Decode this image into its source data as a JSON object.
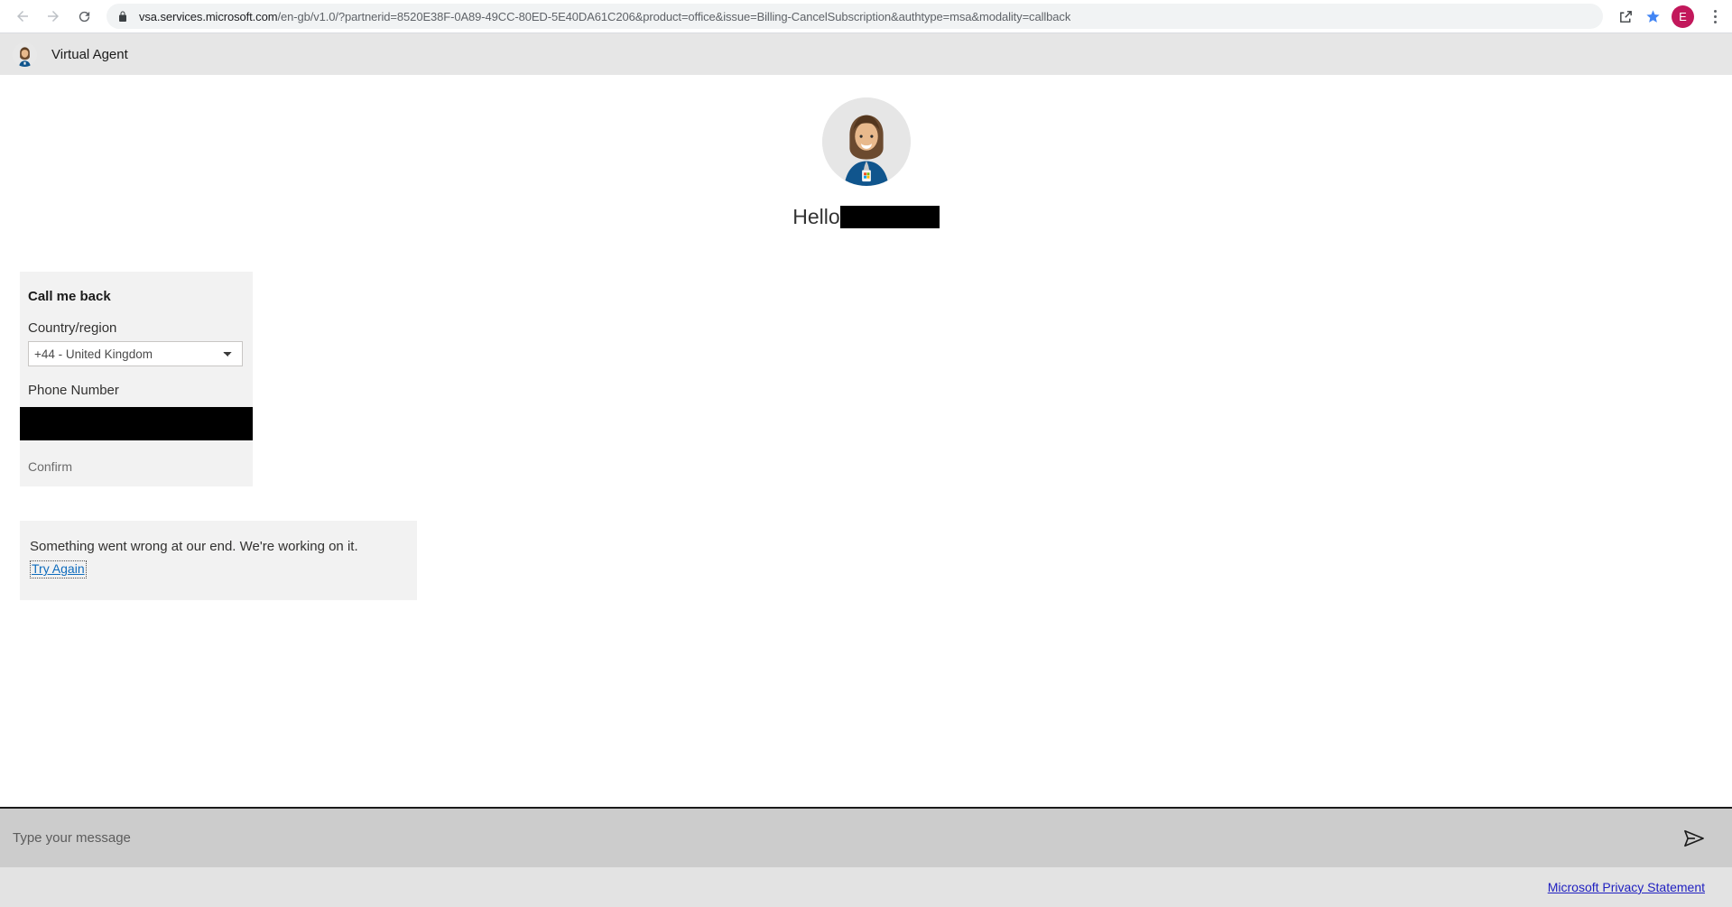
{
  "browser": {
    "back_label": "Back",
    "forward_label": "Forward",
    "reload_label": "Reload",
    "lock_icon": "lock-icon",
    "url_host": "vsa.services.microsoft.com",
    "url_path": "/en-gb/v1.0/?partnerid=8520E38F-0A89-49CC-80ED-5E40DA61C206&product=office&issue=Billing-CancelSubscription&authtype=msa&modality=callback",
    "share_icon": "share-icon",
    "bookmark_icon": "star-icon",
    "bookmark_color": "#4285f4",
    "profile_initial": "E",
    "profile_color": "#c2185b",
    "menu_icon": "kebab-menu-icon"
  },
  "va_header": {
    "title": "Virtual Agent",
    "avatar_icon": "agent-avatar-icon",
    "background": "#e6e6e6"
  },
  "hero": {
    "avatar_icon": "agent-avatar-large",
    "greeting": "Hello",
    "name_redacted": true
  },
  "callback_card": {
    "title": "Call me back",
    "country_label": "Country/region",
    "country_selected": "+44 - United Kingdom",
    "country_options": [
      "+44 - United Kingdom"
    ],
    "phone_label": "Phone Number",
    "phone_value_redacted": true,
    "confirm_label": "Confirm",
    "background": "#f2f2f2"
  },
  "error_card": {
    "message": "Something went wrong at our end. We're working on it.",
    "retry_label": "Try Again",
    "retry_color": "#0f6cbd",
    "background": "#f2f2f2"
  },
  "composer": {
    "placeholder": "Type your message",
    "value": "",
    "send_icon": "send-paper-plane-icon",
    "background": "#cccccc"
  },
  "footer": {
    "privacy_label": "Microsoft Privacy Statement",
    "privacy_color": "#2020c0",
    "background": "#e3e3e3"
  }
}
